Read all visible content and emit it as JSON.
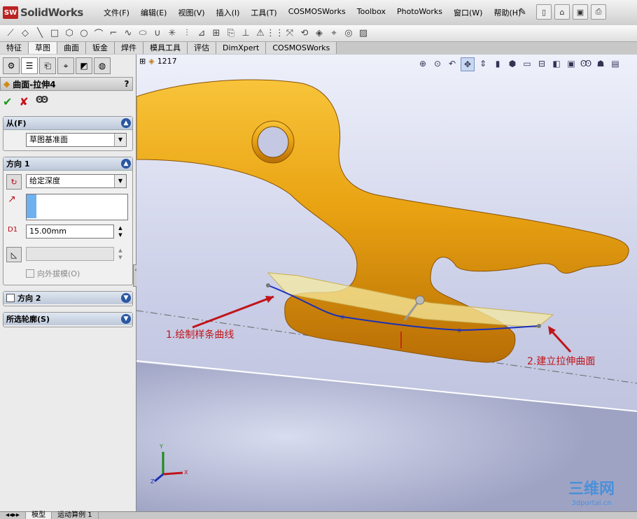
{
  "app": {
    "name": "SolidWorks",
    "logo_mark": "SW"
  },
  "menu": [
    "文件(F)",
    "编辑(E)",
    "视图(V)",
    "插入(I)",
    "工具(T)",
    "COSMOSWorks",
    "Toolbox",
    "PhotoWorks",
    "窗口(W)",
    "帮助(H)"
  ],
  "command_tabs": [
    "特征",
    "草图",
    "曲面",
    "钣金",
    "焊件",
    "模具工具",
    "评估",
    "DimXpert",
    "COSMOSWorks"
  ],
  "active_command_tab": "草图",
  "property_manager": {
    "title": "曲面-拉伸4",
    "help": "?",
    "from_group": {
      "label": "从(F)",
      "value": "草图基准面"
    },
    "direction1": {
      "label": "方向 1",
      "end_condition": "给定深度",
      "depth": "15.00mm",
      "depth_icon_label": "D1",
      "draft_outward_label": "向外拔模(O)"
    },
    "direction2": {
      "label": "方向 2"
    },
    "selected_contours": {
      "label": "所选轮廓(S)"
    }
  },
  "viewport": {
    "tree_count": "1217",
    "annotation1": "1.绘制样条曲线",
    "annotation2": "2.建立拉伸曲面",
    "triad": {
      "x": "X",
      "y": "Y",
      "z": "Z"
    }
  },
  "bottom_tabs": [
    "模型",
    "运动算例 1"
  ],
  "watermark": {
    "title": "三维网",
    "sub": "3dportal.cn"
  },
  "colors": {
    "part": "#e8a010",
    "spline": "#1a2fb8",
    "surface": "#f5e9a0",
    "callout": "#c0141a"
  }
}
